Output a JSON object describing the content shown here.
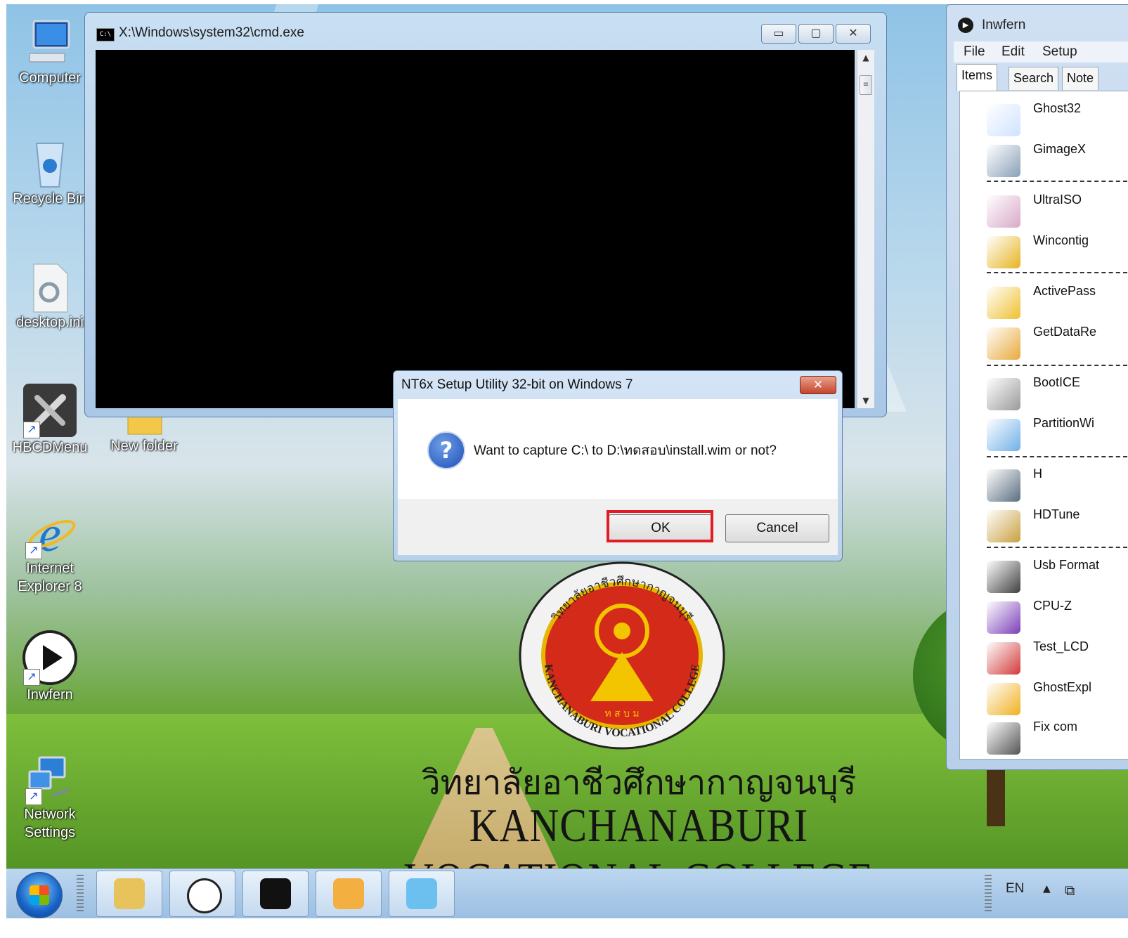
{
  "desktop": {
    "icons": [
      {
        "label": "Computer",
        "icon": "computer-icon"
      },
      {
        "label": "Recycle Bin",
        "icon": "recycle-bin-icon"
      },
      {
        "label": "desktop.ini",
        "icon": "settings-file-icon"
      },
      {
        "label": "HBCDMenu",
        "icon": "tools-icon"
      },
      {
        "label": "New folder",
        "icon": "folder-icon"
      },
      {
        "label": "Internet Explorer 8",
        "icon": "internet-explorer-icon"
      },
      {
        "label": "Inwfern",
        "icon": "play-icon"
      },
      {
        "label": "Network Settings",
        "icon": "network-icon"
      }
    ],
    "wallpaper": {
      "emblem_top": "วิทยาลัยอาชีวศึกษากาญจนบุรี",
      "emblem_bottom": "KANCHANABURI VOCATIONAL COLLEGE",
      "emblem_center": "ท ส บ ม",
      "college_th": "วิทยาลัยอาชีวศึกษากาญจนบุรี",
      "college_en": "KANCHANABURI VOCATIONAL COLLEGE"
    }
  },
  "cmd_window": {
    "title": "X:\\Windows\\system32\\cmd.exe",
    "icon_text": "C:\\",
    "buttons": {
      "minimize": "▭",
      "maximize": "▢",
      "close": "✕"
    }
  },
  "dialog": {
    "title": "NT6x Setup Utility 32-bit on Windows 7",
    "message": "Want to capture C:\\ to D:\\ทดสอบ\\install.wim or not?",
    "ok_label": "OK",
    "cancel_label": "Cancel",
    "close_glyph": "✕",
    "icon_glyph": "?",
    "highlight_color": "#e21b24"
  },
  "launcher": {
    "title": "Inwfern",
    "menu": [
      "File",
      "Edit",
      "Setup"
    ],
    "tabs": [
      "Items",
      "Search",
      "Note"
    ],
    "items": [
      {
        "name": "Ghost32",
        "icon": "ghost-icon",
        "color": "#cfe3ff"
      },
      {
        "name": "GimageX",
        "icon": "gimagex-icon",
        "color": "#8aa0b8"
      },
      {
        "name": "UltraISO",
        "icon": "disc-icon",
        "color": "#d9a9c8"
      },
      {
        "name": "Wincontig",
        "icon": "wincontig-icon",
        "color": "#e6b420"
      },
      {
        "name": "ActivePass",
        "icon": "key-icon",
        "color": "#f0c030"
      },
      {
        "name": "GetDataRe",
        "icon": "recovery-icon",
        "color": "#e9a93a"
      },
      {
        "name": "BootICE",
        "icon": "floppy-icon",
        "color": "#9a9a9a"
      },
      {
        "name": "PartitionWi",
        "icon": "partition-icon",
        "color": "#6fb0e8"
      },
      {
        "name": "H",
        "icon": "harddisk-icon",
        "color": "#5a6d80"
      },
      {
        "name": "HDTune",
        "icon": "hdtune-icon",
        "color": "#c9a040"
      },
      {
        "name": "Usb Format",
        "icon": "usb-icon",
        "color": "#404040"
      },
      {
        "name": "CPU-Z",
        "icon": "cpuz-icon",
        "color": "#7b3fb8"
      },
      {
        "name": "Test_LCD",
        "icon": "lcd-test-icon",
        "color": "#d23a3a"
      },
      {
        "name": "GhostExpl",
        "icon": "ghost-explorer-icon",
        "color": "#f0b020"
      },
      {
        "name": "Fix com",
        "icon": "gear-icon",
        "color": "#555555"
      }
    ]
  },
  "taskbar": {
    "buttons": [
      {
        "icon": "explorer-icon",
        "color": "#e8c25a"
      },
      {
        "icon": "play-icon",
        "color": "#222222"
      },
      {
        "icon": "cmd-icon",
        "color": "#111111"
      },
      {
        "icon": "paint-icon",
        "color": "#f3b040"
      },
      {
        "icon": "app-icon",
        "color": "#6cc0ef"
      }
    ],
    "tray": {
      "lang": "EN",
      "up": "▲",
      "net": "⧉"
    }
  }
}
